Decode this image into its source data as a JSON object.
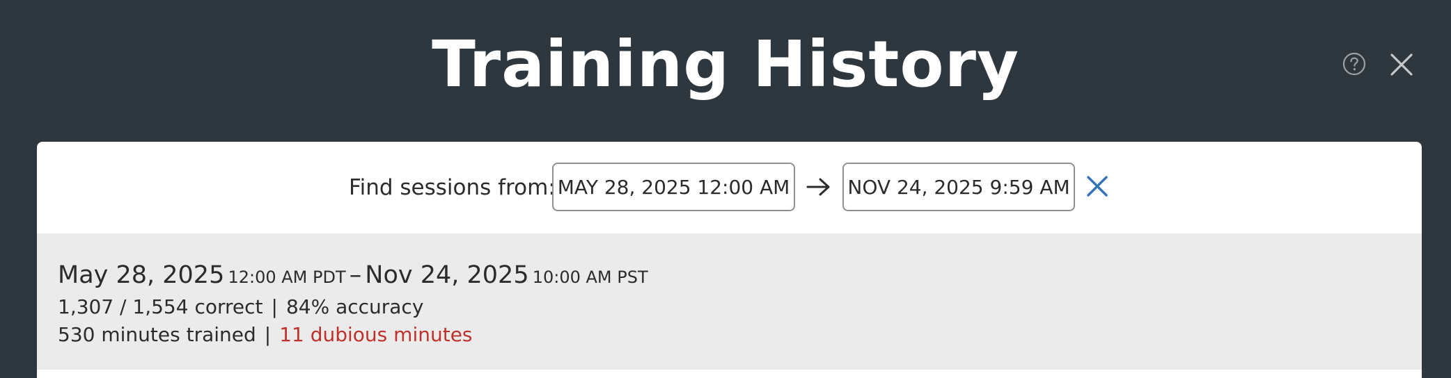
{
  "header": {
    "title": "Training History"
  },
  "icons": {
    "help": "help-circle-icon",
    "close": "close-icon",
    "arrow": "arrow-right-icon",
    "clear": "clear-x-icon"
  },
  "filter": {
    "label": "Find sessions from:",
    "from_value": "MAY 28, 2025 12:00 AM",
    "to_value": "NOV 24, 2025 9:59 AM"
  },
  "summary": {
    "start_date": "May 28, 2025",
    "start_time": "12:00 AM PDT",
    "dash": "–",
    "end_date": "Nov 24, 2025",
    "end_time": "10:00 AM PST",
    "correct": "1,307 / 1,554 correct",
    "separator": "|",
    "accuracy": "84% accuracy",
    "minutes_trained": "530 minutes trained",
    "dubious_minutes": "11 dubious minutes"
  },
  "colors": {
    "header_bg": "#2d373d",
    "panel_bg": "#ffffff",
    "summary_bg": "#ebebeb",
    "accent_blue": "#2f74b8",
    "dubious_red": "#c0312b"
  }
}
